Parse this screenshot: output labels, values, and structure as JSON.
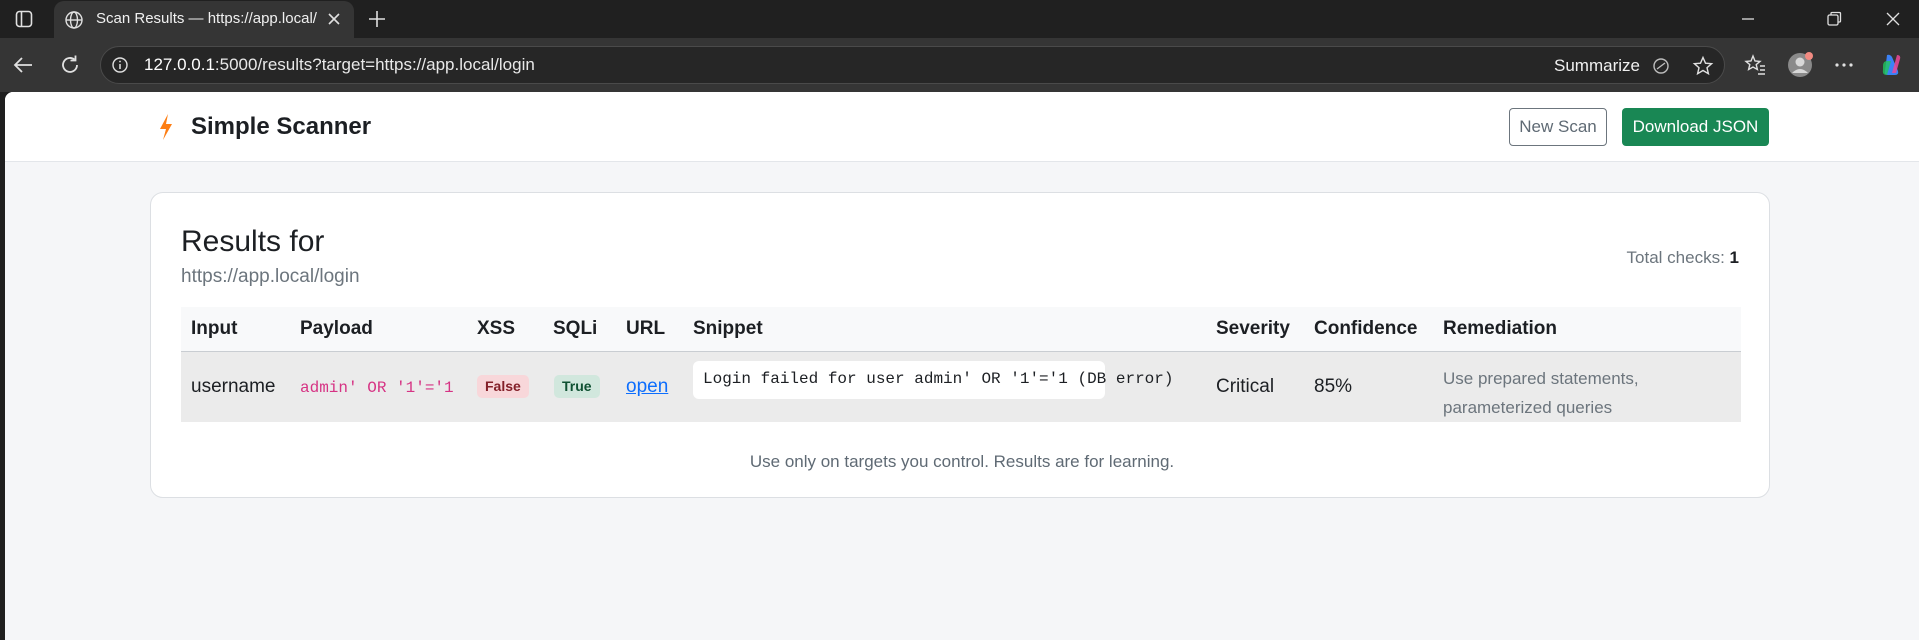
{
  "browser": {
    "tab_title": "Scan Results — https://app.local/l",
    "url_host": "127.0.0.1",
    "url_rest": ":5000/results?target=https://app.local/login",
    "summarize_label": "Summarize"
  },
  "header": {
    "brand": "Simple Scanner",
    "new_scan_label": "New Scan",
    "download_label": "Download JSON"
  },
  "results": {
    "title": "Results for",
    "target": "https://app.local/login",
    "total_checks_label": "Total checks:",
    "total_checks_value": "1",
    "columns": [
      "Input",
      "Payload",
      "XSS",
      "SQLi",
      "URL",
      "Snippet",
      "Severity",
      "Confidence",
      "Remediation"
    ],
    "rows": [
      {
        "input": "username",
        "payload": "admin' OR '1'='1",
        "xss": "False",
        "sqli": "True",
        "url": "open",
        "snippet": "Login failed for user admin' OR '1'='1 (DB error)",
        "severity": "Critical",
        "confidence": "85%",
        "remediation": "Use prepared statements, parameterized queries"
      }
    ]
  },
  "footer": {
    "note": "Use only on targets you control. Results are for learning."
  },
  "colors": {
    "accent_green": "#198754",
    "bolt_orange": "#fd7e14",
    "payload_pink": "#d63384",
    "link_blue": "#0d6efd"
  }
}
